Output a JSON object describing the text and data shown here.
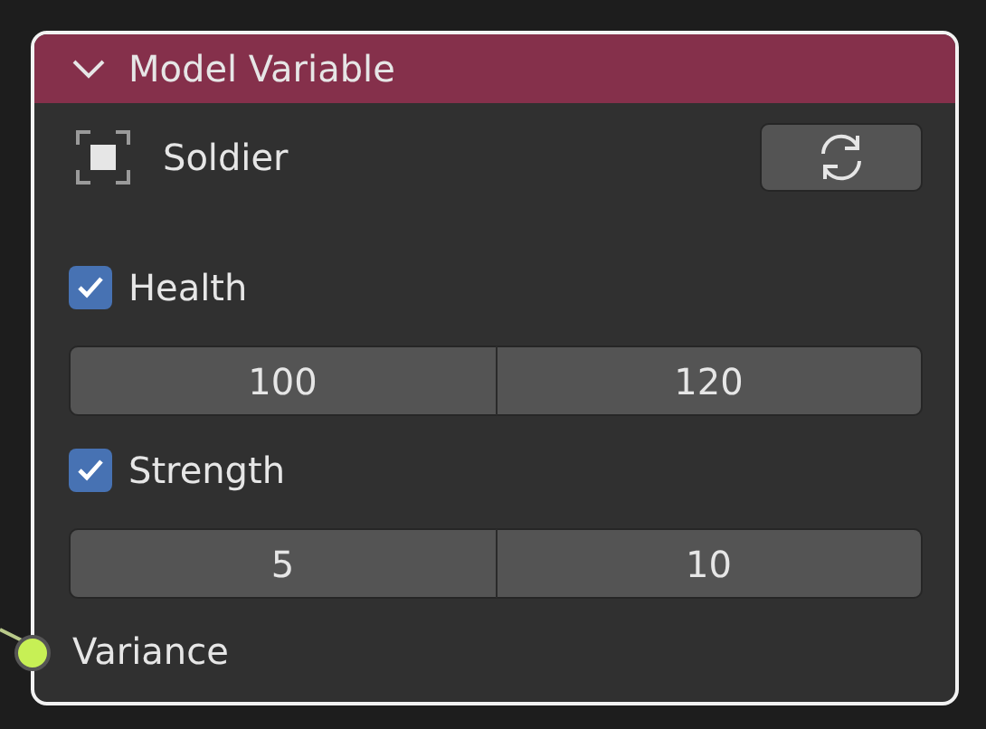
{
  "node": {
    "title": "Model Variable",
    "expanded": true
  },
  "object": {
    "name": "Soldier"
  },
  "properties": [
    {
      "label": "Health",
      "checked": true,
      "min": "100",
      "max": "120"
    },
    {
      "label": "Strength",
      "checked": true,
      "min": "5",
      "max": "10"
    }
  ],
  "output": {
    "label": "Variance",
    "connected": true
  }
}
